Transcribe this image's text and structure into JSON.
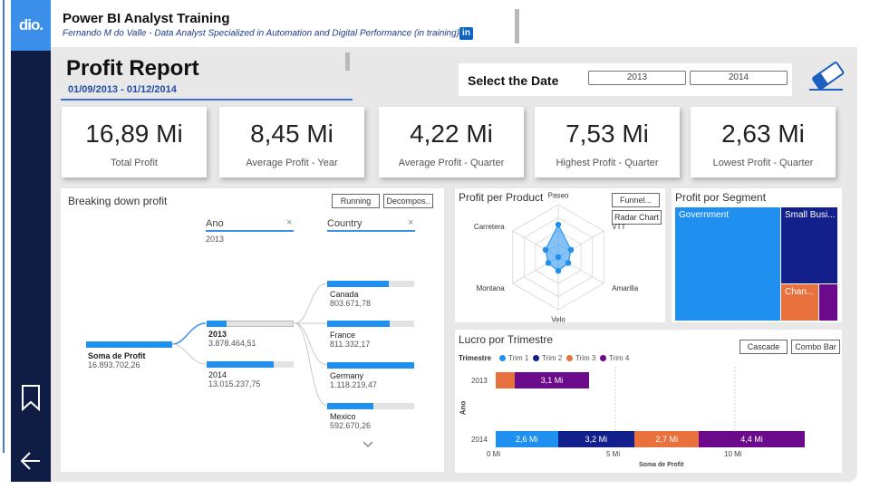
{
  "header": {
    "title": "Power BI Analyst Training",
    "subtitle": "Fernando M do Valle - Data Analyst Specialized in Automation and Digital Performance (in training)",
    "logo": "dio.",
    "linkedin_icon": "in"
  },
  "report": {
    "title": "Profit Report",
    "date_range": "01/09/2013 - 01/12/2014"
  },
  "date_filter": {
    "label": "Select the Date",
    "options": [
      "2013",
      "2014"
    ]
  },
  "kpis": [
    {
      "value": "16,89 Mi",
      "label": "Total Profit"
    },
    {
      "value": "8,45 Mi",
      "label": "Average Profit - Year"
    },
    {
      "value": "4,22 Mi",
      "label": "Average Profit - Quarter"
    },
    {
      "value": "7,53 Mi",
      "label": "Highest Profit - Quarter"
    },
    {
      "value": "2,63 Mi",
      "label": "Lowest Profit - Quarter"
    }
  ],
  "breakdown": {
    "title": "Breaking down profit",
    "buttons": [
      "Running",
      "Decompos.."
    ],
    "root": {
      "name": "Soma de Profit",
      "value": "16.893.702,26"
    },
    "level1": {
      "header": "Ano",
      "filter": "2013",
      "nodes": [
        {
          "name": "2013",
          "value": "3.878.464,51",
          "share": 0.23
        },
        {
          "name": "2014",
          "value": "13.015.237,75",
          "share": 0.77
        }
      ]
    },
    "level2": {
      "header": "Country",
      "nodes": [
        {
          "name": "Canada",
          "value": "803.671,78",
          "share": 0.71
        },
        {
          "name": "France",
          "value": "811.332,17",
          "share": 0.72
        },
        {
          "name": "Germany",
          "value": "1.118.219,47",
          "share": 1.0
        },
        {
          "name": "Mexico",
          "value": "592.670,26",
          "share": 0.53
        }
      ]
    },
    "close_icon": "×",
    "more_icon": "chevron-down-icon"
  },
  "product": {
    "title": "Profit per Product",
    "buttons": [
      "Funnel...",
      "Radar Chart"
    ],
    "axes": [
      "Paseo",
      "VTT",
      "Amarilla",
      "Velo",
      "Montana",
      "Carretera"
    ],
    "values": [
      0.62,
      0.28,
      0.22,
      0.26,
      0.22,
      0.28
    ]
  },
  "segment": {
    "title": "Profit por Segment",
    "cells": [
      "Government",
      "Small Busi...",
      "Chan..."
    ],
    "colors": {
      "government": "#1f8ff0",
      "small_business": "#13208b",
      "channel": "#e8713d",
      "other": "#6b0a8a"
    }
  },
  "trimestre": {
    "title": "Lucro por Trimestre",
    "buttons": [
      "Cascade",
      "Combo Bar"
    ],
    "legend_title": "Trimestre",
    "legend": [
      {
        "name": "Trim 1",
        "color": "#1f8ff0"
      },
      {
        "name": "Trim 2",
        "color": "#13208b"
      },
      {
        "name": "Trim 3",
        "color": "#e8713d"
      },
      {
        "name": "Trim 4",
        "color": "#6b0a8a"
      }
    ],
    "y_axis_label": "Ano",
    "x_axis_label": "Soma de Profit",
    "x_ticks": [
      "0 Mi",
      "5 Mi",
      "10 Mi"
    ]
  },
  "chart_data": {
    "type": "bar",
    "orientation": "horizontal",
    "stacked": true,
    "title": "Lucro por Trimestre",
    "xlabel": "Soma de Profit",
    "ylabel": "Ano",
    "categories": [
      "2013",
      "2014"
    ],
    "series": [
      {
        "name": "Trim 1",
        "values": [
          0,
          2.6
        ]
      },
      {
        "name": "Trim 2",
        "values": [
          0,
          3.2
        ]
      },
      {
        "name": "Trim 3",
        "values": [
          0.8,
          2.7
        ]
      },
      {
        "name": "Trim 4",
        "values": [
          3.1,
          4.4
        ]
      }
    ],
    "data_labels": [
      [
        "",
        "",
        "",
        "3,1 Mi"
      ],
      [
        "2,6 Mi",
        "3,2 Mi",
        "2,7 Mi",
        "4,4 Mi"
      ]
    ],
    "xlim": [
      0,
      13.5
    ],
    "x_ticks": [
      "0 Mi",
      "5 Mi",
      "10 Mi"
    ],
    "legend": "top-left"
  }
}
